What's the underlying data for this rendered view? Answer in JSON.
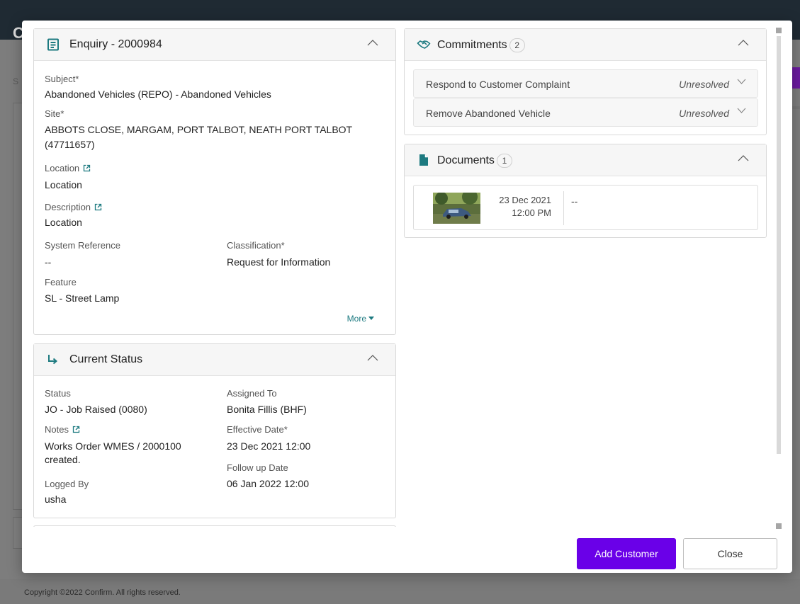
{
  "background": {
    "logo_letter": "C",
    "search_letter": "S",
    "footer_text": "Copyright ©2022 Confirm. All rights reserved."
  },
  "enquiry": {
    "title": "Enquiry - 2000984",
    "subject_label": "Subject*",
    "subject_value": "Abandoned Vehicles (REPO) - Abandoned Vehicles",
    "site_label": "Site*",
    "site_value_line1": "ABBOTS CLOSE, MARGAM, PORT TALBOT, NEATH PORT TALBOT",
    "site_value_line2": "(47711657)",
    "location_label": "Location",
    "location_value": "Location",
    "description_label": "Description",
    "description_value": "Location",
    "system_reference_label": "System Reference",
    "system_reference_value": "--",
    "classification_label": "Classification*",
    "classification_value": "Request for Information",
    "feature_label": "Feature",
    "feature_value": "SL - Street Lamp",
    "more_label": "More"
  },
  "status": {
    "title": "Current Status",
    "status_label": "Status",
    "status_value": "JO - Job Raised (0080)",
    "assigned_label": "Assigned To",
    "assigned_value": "Bonita Fillis (BHF)",
    "notes_label": "Notes",
    "notes_value_line1": "Works Order WMES / 2000100",
    "notes_value_line2": "created.",
    "effective_label": "Effective Date*",
    "effective_value": "23 Dec 2021 12:00",
    "followup_label": "Follow up Date",
    "followup_value": "06 Jan 2022 12:00",
    "logged_label": "Logged By",
    "logged_value": "usha"
  },
  "commitments": {
    "title": "Commitments",
    "count": "2",
    "items": [
      {
        "name": "Respond to Customer Complaint",
        "state": "Unresolved"
      },
      {
        "name": "Remove Abandoned Vehicle",
        "state": "Unresolved"
      }
    ]
  },
  "documents": {
    "title": "Documents",
    "count": "1",
    "items": [
      {
        "date": "23 Dec 2021",
        "time": "12:00 PM",
        "description": "--"
      }
    ]
  },
  "actions": {
    "add_customer": "Add Customer",
    "close": "Close"
  },
  "colors": {
    "accent_teal": "#1d7a80",
    "primary_button": "#6a00e8"
  }
}
